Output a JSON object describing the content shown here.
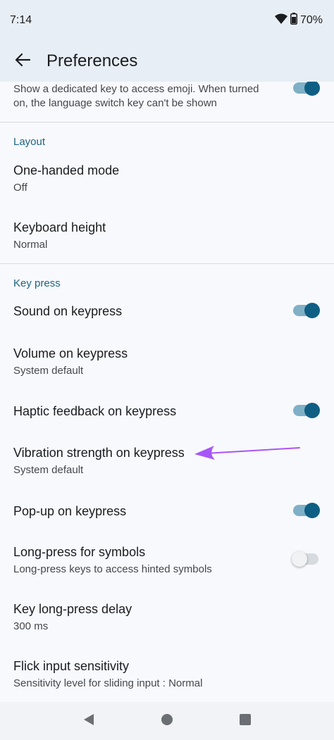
{
  "status_bar": {
    "time": "7:14",
    "battery": "70%",
    "wifi_icon": "wifi-icon",
    "battery_icon": "battery-icon"
  },
  "app_bar": {
    "title": "Preferences",
    "back_icon": "arrow-back-icon"
  },
  "emoji_item": {
    "subtitle_line1": "Show a dedicated key to access emoji. When turned",
    "subtitle_line2": "on, the language switch key can't be shown",
    "enabled": true
  },
  "layout_section": {
    "header": "Layout",
    "one_handed": {
      "title": "One-handed mode",
      "subtitle": "Off"
    },
    "keyboard_height": {
      "title": "Keyboard height",
      "subtitle": "Normal"
    }
  },
  "keypress_section": {
    "header": "Key press",
    "sound": {
      "title": "Sound on keypress",
      "enabled": true
    },
    "volume": {
      "title": "Volume on keypress",
      "subtitle": "System default"
    },
    "haptic": {
      "title": "Haptic feedback on keypress",
      "enabled": true
    },
    "vibration": {
      "title": "Vibration strength on keypress",
      "subtitle": "System default"
    },
    "popup": {
      "title": "Pop-up on keypress",
      "enabled": true
    },
    "long_press_symbols": {
      "title": "Long-press for symbols",
      "subtitle": "Long-press keys to access hinted symbols",
      "enabled": false
    },
    "long_press_delay": {
      "title": "Key long-press delay",
      "subtitle": "300 ms"
    },
    "flick": {
      "title": "Flick input sensitivity",
      "subtitle": "Sensitivity level for sliding input : Normal"
    }
  },
  "colors": {
    "accent": "#0f5f84",
    "accent_track": "#7fb0c6",
    "section_header": "#1d6480",
    "annotation_arrow": "#a855f7"
  },
  "nav": {
    "back": "nav-back-icon",
    "home": "nav-home-icon",
    "recents": "nav-recents-icon"
  }
}
